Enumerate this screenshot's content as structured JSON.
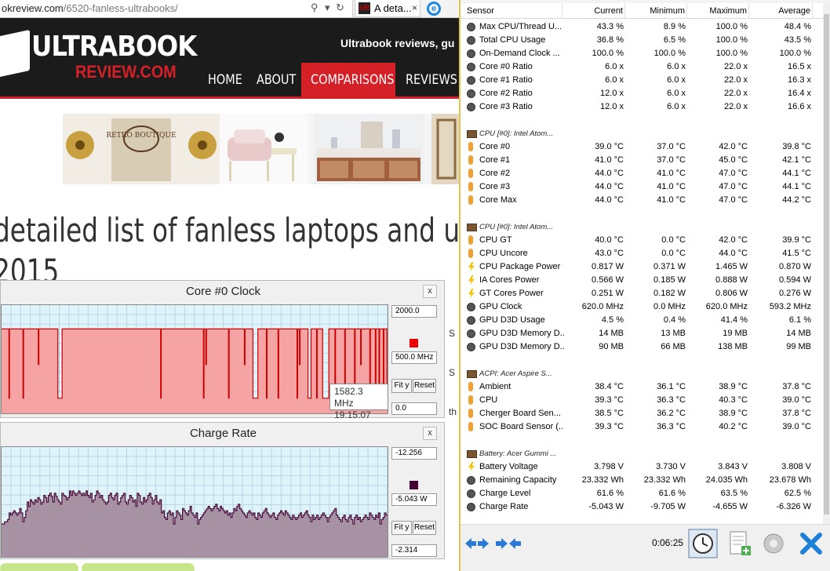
{
  "browser": {
    "url_prefix": "okreview.com",
    "url_path": "/6520-fanless-ultrabooks/",
    "tab_title": "A deta...",
    "tab_favicon": "UR",
    "tab_close": "×"
  },
  "site": {
    "logo_line1": "ULTRABOOK",
    "logo_line2": "REVIEW.COM",
    "tagline": "Ultrabook reviews, gu",
    "nav": [
      "HOME",
      "ABOUT",
      "COMPARISONS",
      "REVIEWS"
    ],
    "headline_line1": "detailed list of fanless laptops and u",
    "headline_line2": "2015",
    "side_letters": [
      "S",
      "S",
      "th"
    ],
    "banner_text": "RETRO BOUTIQUE"
  },
  "graph_clock": {
    "title": "Core #0 Clock",
    "close": "x",
    "max_field": "2000.0",
    "mid_field": "500.0 MHz",
    "min_field": "0.0",
    "fit_label": "Fit y",
    "reset_label": "Reset",
    "swatch_color": "#ee0000",
    "fill_color": "#f6a3a3",
    "line_color": "#cc0000",
    "tooltip_value": "1582.3 MHz",
    "tooltip_time": "19:15:07",
    "levels": [
      0.78,
      0.78,
      0.78,
      0.78,
      0.78,
      0.78,
      0.78,
      0.78,
      0.78,
      0.78,
      0.78,
      0.78,
      0.14,
      0.78,
      0.78,
      0.78,
      0.78,
      0.78,
      0.78,
      0.78,
      0.78,
      0.78,
      0.78,
      0.78,
      0.78,
      0.78,
      0.78,
      0.78,
      0.78,
      0.78,
      0.78,
      0.78,
      0.78,
      0.78,
      0.78,
      0.14,
      0.78,
      0.78,
      0.78,
      0.78,
      0.78,
      0.78,
      0.78,
      0.78,
      0.78,
      0.78,
      0.78,
      0.78,
      0.78,
      0.78,
      0.78,
      0.78,
      0.78,
      0.78,
      0.78,
      0.78,
      0.78,
      0.78,
      0.78,
      0.78,
      0.45,
      0.78,
      0.78,
      0.78,
      0.78,
      0.78,
      0.78,
      0.78,
      0.78,
      0.78,
      0.78,
      0.78,
      0.78,
      0.78,
      0.78,
      0.78,
      0.78,
      0.78,
      0.78,
      0.78,
      0.78,
      0.78,
      0.78,
      0.78,
      0.78,
      0.78,
      0.78,
      0.78,
      0.78,
      0.78,
      0.78,
      0.78,
      0.14,
      0.14,
      0.14,
      0.14,
      0.14,
      0.14,
      0.14,
      0.78,
      0.78,
      0.78,
      0.78,
      0.78,
      0.78,
      0.78,
      0.78,
      0.78,
      0.78,
      0.78,
      0.78,
      0.78,
      0.78,
      0.78,
      0.78,
      0.78,
      0.78,
      0.78,
      0.78,
      0.78,
      0.78,
      0.78,
      0.78,
      0.78,
      0.78,
      0.78,
      0.78,
      0.78,
      0.78,
      0.78,
      0.78,
      0.78,
      0.78,
      0.78,
      0.78,
      0.78,
      0.78,
      0.78,
      0.78,
      0.78,
      0.78,
      0.78,
      0.78,
      0.78,
      0.78,
      0.78,
      0.78,
      0.78,
      0.78,
      0.78,
      0.78,
      0.78,
      0.78,
      0.78,
      0.78,
      0.78,
      0.78,
      0.78,
      0.78,
      0.78,
      0.78,
      0.78,
      0.78,
      0.78,
      0.78,
      0.78,
      0.78,
      0.78,
      0.78,
      0.78,
      0.78,
      0.78,
      0.78,
      0.78,
      0.78,
      0.78,
      0.78,
      0.78,
      0.78,
      0.78,
      0.78,
      0.78,
      0.78,
      0.78,
      0.78,
      0.78,
      0.78,
      0.78,
      0.78,
      0.78,
      0.78,
      0.78,
      0.78,
      0.78,
      0.78,
      0.78,
      0.78,
      0.78,
      0.78,
      0.78,
      0.78,
      0.78,
      0.78,
      0.78,
      0.78,
      0.78,
      0.78,
      0.78,
      0.78,
      0.78,
      0.78,
      0.78,
      0.78,
      0.78,
      0.78,
      0.78,
      0.78,
      0.78,
      0.78,
      0.78,
      0.78,
      0.78,
      0.78,
      0.78,
      0.78,
      0.78,
      0.78,
      0.78,
      0.78,
      0.78,
      0.78,
      0.78,
      0.78,
      0.78,
      0.78,
      0.78,
      0.78,
      0.78,
      0.78,
      0.78,
      0.78,
      0.78,
      0.78,
      0.78,
      0.78,
      0.78,
      0.78,
      0.78,
      0.78,
      0.78,
      0.78,
      0.78,
      0.78,
      0.78,
      0.78,
      0.78,
      0.78,
      0.78,
      0.78,
      0.78,
      0.14,
      0.78,
      0.78,
      0.78,
      0.78,
      0.78,
      0.78,
      0.78,
      0.78,
      0.78,
      0.78,
      0.78,
      0.78,
      0.78,
      0.78,
      0.78,
      0.78,
      0.78,
      0.78,
      0.78,
      0.78,
      0.78,
      0.78,
      0.78,
      0.78,
      0.78,
      0.78,
      0.78,
      0.78,
      0.78,
      0.78,
      0.78,
      0.78,
      0.78,
      0.78,
      0.78,
      0.78,
      0.78,
      0.78,
      0.78,
      0.78,
      0.78,
      0.78,
      0.78,
      0.78,
      0.78,
      0.78,
      0.78,
      0.78,
      0.78,
      0.78,
      0.78,
      0.78,
      0.78,
      0.78,
      0.78,
      0.78,
      0.78,
      0.78,
      0.78,
      0.78,
      0.78,
      0.78,
      0.78,
      0.78,
      0.78,
      0.78,
      0.78,
      0.78,
      0.78,
      0.14,
      0.78,
      0.78,
      0.78,
      0.45,
      0.78,
      0.78,
      0.78,
      0.78,
      0.78,
      0.78,
      0.78,
      0.78,
      0.78,
      0.78,
      0.78,
      0.78,
      0.78,
      0.78,
      0.78,
      0.78,
      0.78,
      0.78,
      0.78,
      0.78,
      0.78,
      0.78,
      0.78,
      0.78,
      0.78,
      0.78,
      0.78,
      0.78,
      0.78,
      0.78,
      0.78,
      0.78,
      0.78,
      0.78,
      0.78,
      0.78,
      0.14,
      0.78,
      0.78,
      0.78,
      0.78,
      0.78,
      0.78,
      0.78,
      0.78,
      0.78,
      0.78,
      0.78,
      0.78,
      0.78,
      0.78,
      0.78,
      0.78,
      0.78,
      0.78,
      0.78,
      0.78,
      0.78,
      0.78,
      0.78,
      0.78,
      0.78,
      0.45,
      0.78,
      0.78,
      0.78,
      0.78,
      0.78,
      0.78,
      0.78,
      0.78,
      0.78,
      0.78,
      0.78,
      0.78,
      0.78,
      0.14,
      0.14,
      0.14,
      0.14,
      0.14,
      0.14,
      0.14,
      0.14,
      0.78,
      0.78,
      0.78,
      0.78,
      0.78,
      0.78,
      0.78,
      0.78,
      0.78,
      0.78,
      0.78,
      0.78,
      0.78,
      0.78,
      0.14,
      0.78,
      0.78,
      0.78,
      0.78,
      0.78,
      0.78,
      0.78,
      0.78,
      0.78,
      0.78,
      0.78,
      0.78,
      0.78,
      0.78,
      0.78,
      0.78,
      0.78,
      0.78,
      0.14,
      0.78,
      0.78,
      0.78,
      0.78,
      0.78,
      0.78,
      0.78,
      0.78,
      0.78,
      0.78,
      0.78,
      0.78,
      0.78,
      0.78,
      0.78,
      0.78,
      0.78,
      0.78,
      0.78,
      0.78,
      0.78,
      0.78,
      0.78,
      0.78,
      0.78,
      0.78,
      0.78,
      0.78,
      0.78,
      0.78,
      0.14,
      0.78,
      0.78,
      0.78,
      0.45,
      0.78,
      0.78,
      0.78,
      0.78,
      0.78,
      0.78,
      0.78,
      0.78,
      0.78,
      0.78,
      0.78,
      0.78,
      0.78,
      0.14,
      0.14,
      0.14,
      0.14,
      0.14,
      0.78,
      0.78,
      0.78,
      0.78,
      0.78,
      0.78,
      0.78,
      0.78,
      0.78,
      0.14,
      0.78,
      0.78,
      0.78,
      0.78,
      0.78,
      0.78,
      0.78,
      0.78,
      0.78,
      0.14,
      0.14,
      0.14,
      0.14,
      0.14,
      0.14,
      0.14,
      0.14,
      0.14,
      0.14,
      0.78,
      0.78,
      0.78,
      0.78,
      0.78,
      0.78,
      0.78,
      0.78,
      0.78,
      0.78,
      0.14,
      0.78,
      0.78,
      0.78,
      0.78,
      0.78,
      0.78,
      0.78,
      0.78,
      0.78,
      0.78,
      0.78,
      0.78,
      0.78,
      0.78,
      0.78,
      0.14,
      0.78,
      0.78,
      0.78,
      0.78,
      0.78,
      0.78,
      0.78,
      0.78,
      0.78,
      0.78,
      0.78,
      0.78,
      0.78,
      0.78,
      0.78,
      0.14,
      0.78,
      0.78,
      0.78,
      0.78,
      0.78,
      0.78,
      0.78,
      0.78,
      0.78,
      0.45,
      0.78,
      0.78,
      0.78,
      0.78,
      0.78,
      0.78,
      0.78,
      0.78,
      0.78,
      0.78,
      0.78,
      0.78,
      0.78,
      0.78,
      0.14,
      0.78,
      0.78,
      0.78,
      0.78,
      0.78,
      0.78,
      0.78,
      0.78,
      0.14,
      0.78,
      0.78,
      0.78,
      0.78,
      0.78,
      0.14,
      0.78,
      0.78,
      0.78,
      0.78,
      0.78,
      0.78,
      0.14,
      0.78,
      0.78,
      0.78,
      0.78,
      0.78,
      0.14
    ]
  },
  "graph_charge": {
    "title": "Charge Rate",
    "close": "x",
    "max_field": "-12.256",
    "mid_field": "-5.043 W",
    "min_field": "-2.314",
    "fit_label": "Fit y",
    "reset_label": "Reset",
    "swatch_color": "#440033",
    "fill_color": "#a792a4",
    "line_color": "#4a0b3a",
    "levels": [
      0.3,
      0.3,
      0.32,
      0.32,
      0.34,
      0.4,
      0.38,
      0.4,
      0.42,
      0.4,
      0.38,
      0.4,
      0.44,
      0.4,
      0.32,
      0.36,
      0.42,
      0.5,
      0.46,
      0.52,
      0.5,
      0.48,
      0.52,
      0.5,
      0.54,
      0.52,
      0.48,
      0.5,
      0.56,
      0.54,
      0.5,
      0.56,
      0.58,
      0.55,
      0.5,
      0.58,
      0.55,
      0.52,
      0.5,
      0.48,
      0.58,
      0.56,
      0.55,
      0.52,
      0.54,
      0.6,
      0.56,
      0.6,
      0.58,
      0.56,
      0.58,
      0.6,
      0.58,
      0.56,
      0.58,
      0.56,
      0.6,
      0.56,
      0.54,
      0.58,
      0.5,
      0.52,
      0.56,
      0.6,
      0.58,
      0.54,
      0.56,
      0.52,
      0.5,
      0.48,
      0.5,
      0.56,
      0.58,
      0.54,
      0.52,
      0.56,
      0.58,
      0.48,
      0.5,
      0.54,
      0.56,
      0.58,
      0.5,
      0.48,
      0.52,
      0.56,
      0.54,
      0.5,
      0.52,
      0.46,
      0.58,
      0.56,
      0.5,
      0.48,
      0.54,
      0.5,
      0.52,
      0.56,
      0.58,
      0.54,
      0.48,
      0.52,
      0.56,
      0.5,
      0.48,
      0.52,
      0.4,
      0.42,
      0.36,
      0.34,
      0.4,
      0.42,
      0.38,
      0.4,
      0.3,
      0.36,
      0.42,
      0.4,
      0.38,
      0.34,
      0.44,
      0.42,
      0.4,
      0.38,
      0.42,
      0.46,
      0.4,
      0.38,
      0.36,
      0.4,
      0.3,
      0.34,
      0.36,
      0.38,
      0.4,
      0.42,
      0.44,
      0.46,
      0.44,
      0.42,
      0.44,
      0.46,
      0.48,
      0.44,
      0.42,
      0.46,
      0.44,
      0.42,
      0.4,
      0.42,
      0.38,
      0.4,
      0.36,
      0.4,
      0.44,
      0.42,
      0.46,
      0.48,
      0.44,
      0.42,
      0.4,
      0.38,
      0.36,
      0.4,
      0.42,
      0.4,
      0.38,
      0.4,
      0.36,
      0.34,
      0.4,
      0.38,
      0.36,
      0.4,
      0.42,
      0.44,
      0.4,
      0.38,
      0.36,
      0.38,
      0.4,
      0.36,
      0.34,
      0.38,
      0.4,
      0.42,
      0.4,
      0.38,
      0.42,
      0.4,
      0.38,
      0.36,
      0.34,
      0.38,
      0.36,
      0.34,
      0.36,
      0.38,
      0.4,
      0.36,
      0.38,
      0.4,
      0.42,
      0.38,
      0.36,
      0.32,
      0.38,
      0.34,
      0.36,
      0.38,
      0.34,
      0.36,
      0.38,
      0.4,
      0.38,
      0.36,
      0.32,
      0.36,
      0.38,
      0.4,
      0.42,
      0.44,
      0.38,
      0.36,
      0.34,
      0.32,
      0.36,
      0.38,
      0.34,
      0.32,
      0.36,
      0.38,
      0.34,
      0.3,
      0.36,
      0.38,
      0.34,
      0.36,
      0.32,
      0.34,
      0.36,
      0.38,
      0.36,
      0.34,
      0.4,
      0.38,
      0.36,
      0.34,
      0.38,
      0.36,
      0.4,
      0.3,
      0.34,
      0.36,
      0.4,
      0.38
    ]
  },
  "hwinfo": {
    "columns": [
      "Sensor",
      "Current",
      "Minimum",
      "Maximum",
      "Average"
    ],
    "timer": "0:06:25",
    "rows": [
      {
        "icon": "round",
        "name": "Max CPU/Thread U...",
        "cur": "43.3 %",
        "min": "8.9 %",
        "max": "100.0 %",
        "avg": "48.4 %"
      },
      {
        "icon": "round",
        "name": "Total CPU Usage",
        "cur": "36.8 %",
        "min": "6.5 %",
        "max": "100.0 %",
        "avg": "43.5 %"
      },
      {
        "icon": "round",
        "name": "On-Demand Clock ...",
        "cur": "100.0 %",
        "min": "100.0 %",
        "max": "100.0 %",
        "avg": "100.0 %"
      },
      {
        "icon": "round",
        "name": "Core #0 Ratio",
        "cur": "6.0 x",
        "min": "6.0 x",
        "max": "22.0 x",
        "avg": "16.5 x"
      },
      {
        "icon": "round",
        "name": "Core #1 Ratio",
        "cur": "6.0 x",
        "min": "6.0 x",
        "max": "22.0 x",
        "avg": "16.3 x"
      },
      {
        "icon": "round",
        "name": "Core #2 Ratio",
        "cur": "12.0 x",
        "min": "6.0 x",
        "max": "22.0 x",
        "avg": "16.4 x"
      },
      {
        "icon": "round",
        "name": "Core #3 Ratio",
        "cur": "12.0 x",
        "min": "6.0 x",
        "max": "22.0 x",
        "avg": "16.6 x"
      },
      {
        "icon": "blank",
        "name": "",
        "cur": "",
        "min": "",
        "max": "",
        "avg": ""
      },
      {
        "icon": "group",
        "name": "CPU [#0]: Intel Atom...",
        "cur": "",
        "min": "",
        "max": "",
        "avg": ""
      },
      {
        "icon": "therm",
        "name": "Core #0",
        "cur": "39.0 °C",
        "min": "37.0 °C",
        "max": "42.0 °C",
        "avg": "39.8 °C"
      },
      {
        "icon": "therm",
        "name": "Core #1",
        "cur": "41.0 °C",
        "min": "37.0 °C",
        "max": "45.0 °C",
        "avg": "42.1 °C"
      },
      {
        "icon": "therm",
        "name": "Core #2",
        "cur": "44.0 °C",
        "min": "41.0 °C",
        "max": "47.0 °C",
        "avg": "44.1 °C"
      },
      {
        "icon": "therm",
        "name": "Core #3",
        "cur": "44.0 °C",
        "min": "41.0 °C",
        "max": "47.0 °C",
        "avg": "44.1 °C"
      },
      {
        "icon": "therm",
        "name": "Core Max",
        "cur": "44.0 °C",
        "min": "41.0 °C",
        "max": "47.0 °C",
        "avg": "44.2 °C"
      },
      {
        "icon": "blank",
        "name": "",
        "cur": "",
        "min": "",
        "max": "",
        "avg": ""
      },
      {
        "icon": "group",
        "name": "CPU [#0]: Intel Atom...",
        "cur": "",
        "min": "",
        "max": "",
        "avg": ""
      },
      {
        "icon": "therm",
        "name": "CPU GT",
        "cur": "40.0 °C",
        "min": "0.0 °C",
        "max": "42.0 °C",
        "avg": "39.9 °C"
      },
      {
        "icon": "therm",
        "name": "CPU Uncore",
        "cur": "43.0 °C",
        "min": "0.0 °C",
        "max": "44.0 °C",
        "avg": "41.5 °C"
      },
      {
        "icon": "bolt",
        "name": "CPU Package Power",
        "cur": "0.817 W",
        "min": "0.371 W",
        "max": "1.465 W",
        "avg": "0.870 W"
      },
      {
        "icon": "bolt",
        "name": "IA Cores Power",
        "cur": "0.566 W",
        "min": "0.185 W",
        "max": "0.888 W",
        "avg": "0.594 W"
      },
      {
        "icon": "bolt",
        "name": "GT Cores Power",
        "cur": "0.251 W",
        "min": "0.182 W",
        "max": "0.806 W",
        "avg": "0.276 W"
      },
      {
        "icon": "round",
        "name": "GPU Clock",
        "cur": "620.0 MHz",
        "min": "0.0 MHz",
        "max": "620.0 MHz",
        "avg": "593.2 MHz"
      },
      {
        "icon": "round",
        "name": "GPU D3D Usage",
        "cur": "4.5 %",
        "min": "0.4 %",
        "max": "41.4 %",
        "avg": "6.1 %"
      },
      {
        "icon": "round",
        "name": "GPU D3D Memory D...",
        "cur": "14 MB",
        "min": "13 MB",
        "max": "19 MB",
        "avg": "14 MB"
      },
      {
        "icon": "round",
        "name": "GPU D3D Memory D...",
        "cur": "90 MB",
        "min": "66 MB",
        "max": "138 MB",
        "avg": "99 MB"
      },
      {
        "icon": "blank",
        "name": "",
        "cur": "",
        "min": "",
        "max": "",
        "avg": ""
      },
      {
        "icon": "group",
        "name": "ACPI: Acer Aspire S...",
        "cur": "",
        "min": "",
        "max": "",
        "avg": ""
      },
      {
        "icon": "therm",
        "name": "Ambient",
        "cur": "38.4 °C",
        "min": "36.1 °C",
        "max": "38.9 °C",
        "avg": "37.8 °C"
      },
      {
        "icon": "therm",
        "name": "CPU",
        "cur": "39.3 °C",
        "min": "36.3 °C",
        "max": "40.3 °C",
        "avg": "39.0 °C"
      },
      {
        "icon": "therm",
        "name": "Cherger Board Sen...",
        "cur": "38.5 °C",
        "min": "36.2 °C",
        "max": "38.9 °C",
        "avg": "37.8 °C"
      },
      {
        "icon": "therm",
        "name": "SOC Board Sensor (...",
        "cur": "39.3 °C",
        "min": "36.3 °C",
        "max": "40.2 °C",
        "avg": "39.0 °C"
      },
      {
        "icon": "blank",
        "name": "",
        "cur": "",
        "min": "",
        "max": "",
        "avg": ""
      },
      {
        "icon": "group",
        "name": "Battery: Acer Gummi ...",
        "cur": "",
        "min": "",
        "max": "",
        "avg": ""
      },
      {
        "icon": "bolt",
        "name": "Battery Voltage",
        "cur": "3.798 V",
        "min": "3.730 V",
        "max": "3.843 V",
        "avg": "3.808 V"
      },
      {
        "icon": "round",
        "name": "Remaining Capacity",
        "cur": "23.332 Wh",
        "min": "23.332 Wh",
        "max": "24.035 Wh",
        "avg": "23.678 Wh"
      },
      {
        "icon": "round",
        "name": "Charge Level",
        "cur": "61.6 %",
        "min": "61.6 %",
        "max": "63.5 %",
        "avg": "62.5 %"
      },
      {
        "icon": "round",
        "name": "Charge Rate",
        "cur": "-5.043 W",
        "min": "-9.705 W",
        "max": "-4.655 W",
        "avg": "-6.326 W"
      }
    ]
  }
}
